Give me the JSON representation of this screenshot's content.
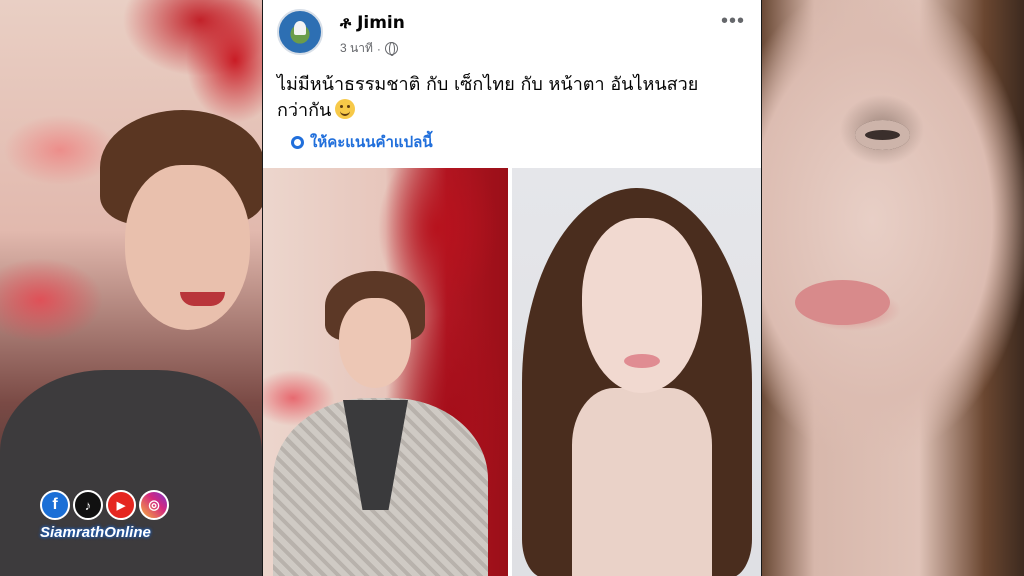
{
  "post": {
    "author": "ቶ Jimin",
    "time": "3 นาที",
    "privacy_separator": "·",
    "privacy_icon": "globe-icon",
    "more_icon": "more-horizontal-icon",
    "more_label": "•••",
    "text_line1": "ไม่มีหน้าธรรมชาติ กับ เซ็กไทย กับ หน้าตา อันไหนสวย",
    "text_line2": "กว่ากัน",
    "emoji": "slightly-smiling-face",
    "translate_label": "ให้คะแนนคำแปลนี้",
    "translate_icon": "gear-icon"
  },
  "logo": {
    "icons": [
      {
        "name": "facebook-icon",
        "glyph": "f"
      },
      {
        "name": "tiktok-icon",
        "glyph": "♪"
      },
      {
        "name": "youtube-icon",
        "glyph": "▶"
      },
      {
        "name": "instagram-icon",
        "glyph": "◎"
      }
    ],
    "brand": "SiamrathOnline"
  },
  "colors": {
    "link": "#216fdb",
    "text": "#050505",
    "meta": "#65676b",
    "brand_outline": "#1b5fc0"
  }
}
